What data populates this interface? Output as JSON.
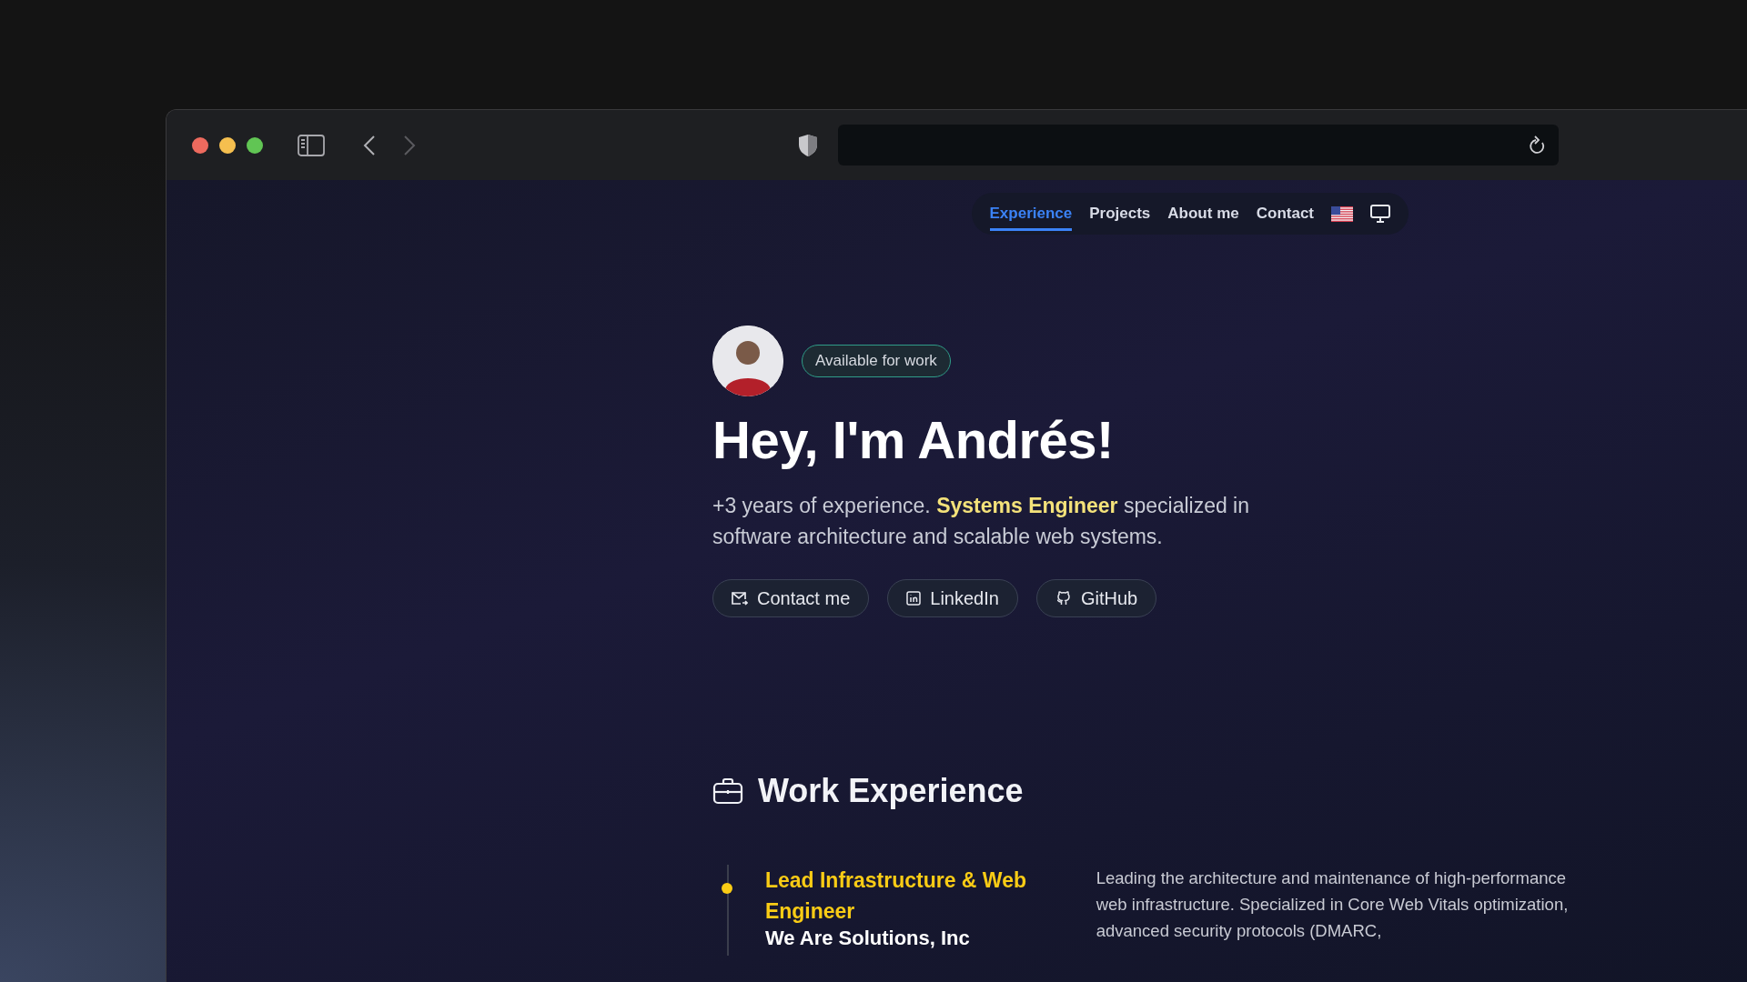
{
  "nav": {
    "links": [
      {
        "label": "Experience",
        "selected": true
      },
      {
        "label": "Projects",
        "selected": false
      },
      {
        "label": "About me",
        "selected": false
      },
      {
        "label": "Contact",
        "selected": false
      }
    ]
  },
  "hero": {
    "badge": "Available for work",
    "heading": "Hey, I'm Andrés!",
    "intro": "+3 years of experience. **Systems Engineer** specialized in software architecture and scalable web systems.",
    "buttons": [
      {
        "label": "Contact me",
        "kind": "mail"
      },
      {
        "label": "LinkedIn",
        "kind": "linkedin"
      },
      {
        "label": "GitHub",
        "kind": "github"
      }
    ]
  },
  "work": {
    "title": "Work Experience",
    "items": [
      {
        "role": "Lead Infrastructure & Web Engineer",
        "company": "We Are Solutions, Inc",
        "description": "Leading the architecture and maintenance of high-performance web infrastructure. Specialized in Core Web Vitals optimization, advanced security protocols (DMARC,"
      }
    ]
  }
}
